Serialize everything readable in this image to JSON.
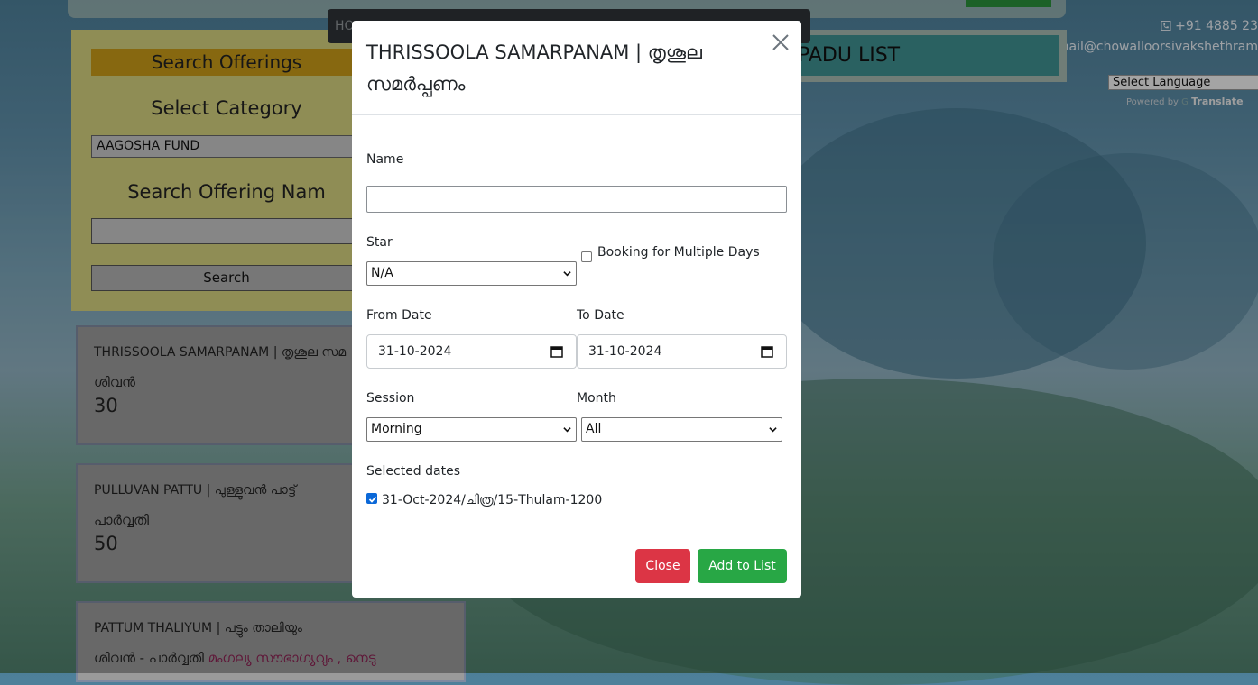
{
  "background": {
    "contact_phone": "+91 4885 23",
    "contact_email": "mail@chowalloorsivakshethram",
    "language_select": "Select Language",
    "powered_by": "Powered by",
    "translate": "Translate",
    "nav_partial": "HO",
    "right_list_title": "PADU LIST"
  },
  "search_panel": {
    "title": "Search Offerings",
    "category_label": "Select Category",
    "category_value": "AAGOSHA FUND",
    "offering_name_label": "Search Offering Nam",
    "search_button": "Search"
  },
  "cards": [
    {
      "title": "THRISSOOLA SAMARPANAM | തൃശൂല സമ",
      "deity": "ശിവൻ",
      "desc_extra": "",
      "price": "30"
    },
    {
      "title": "PULLUVAN PATTU | പുള്ളുവൻ പാട്ട്",
      "deity": "പാർവ്വതി",
      "desc_extra": "",
      "price": "50"
    },
    {
      "title": "PATTUM THALIYUM | പട്ടും താലിയും",
      "deity": "ശിവൻ - പാർവ്വതി",
      "desc_extra": "മംഗല്യ സൗഭാഗ്യവും , നെടു",
      "price": ""
    }
  ],
  "modal": {
    "title": "THRISSOOLA SAMARPANAM | തൃശൂല സമർപ്പണം",
    "name_label": "Name",
    "name_value": "",
    "star_label": "Star",
    "star_value": "N/A",
    "multi_days_label": "Booking for Multiple Days",
    "multi_days_checked": false,
    "from_date_label": "From Date",
    "from_date_value": "31-10-2024",
    "to_date_label": "To Date",
    "to_date_value": "31-10-2024",
    "session_label": "Session",
    "session_value": "Morning",
    "month_label": "Month",
    "month_value": "All",
    "selected_dates_label": "Selected dates",
    "selected_dates": [
      {
        "label": "31-Oct-2024/ചിത്ര/15-Thulam-1200",
        "checked": true
      }
    ],
    "close_button": "Close",
    "add_button": "Add to List"
  },
  "colors": {
    "close_button": "#dc3545",
    "add_button": "#28a745",
    "checkbox_accent": "#0b68d8"
  }
}
